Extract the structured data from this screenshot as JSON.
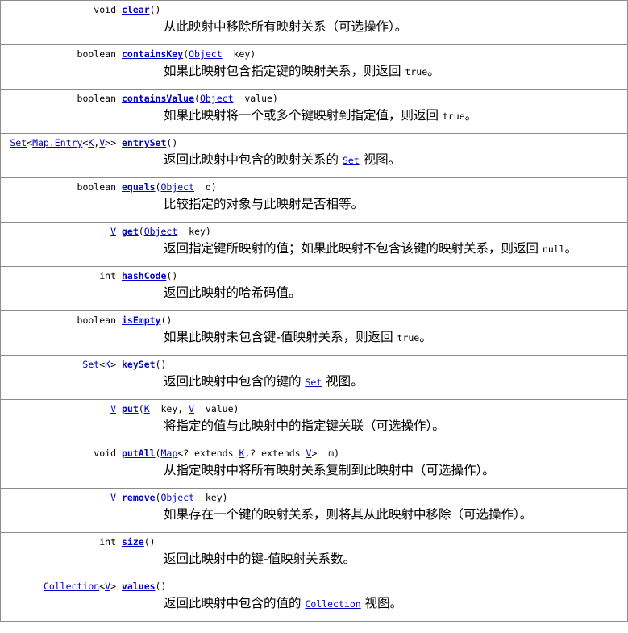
{
  "rows": [
    {
      "type": [
        {
          "t": "void"
        }
      ],
      "method": "clear",
      "params": [
        {
          "t": "()"
        }
      ],
      "desc": [
        {
          "t": "从此映射中移除所有映射关系（可选操作）。"
        }
      ]
    },
    {
      "type": [
        {
          "t": "boolean"
        }
      ],
      "method": "containsKey",
      "params": [
        {
          "t": "("
        },
        {
          "t": "Object",
          "link": true
        },
        {
          "t": "  key)"
        }
      ],
      "desc": [
        {
          "t": "如果此映射包含指定键的映射关系，则返回 "
        },
        {
          "t": "true",
          "code": true
        },
        {
          "t": "。"
        }
      ]
    },
    {
      "type": [
        {
          "t": "boolean"
        }
      ],
      "method": "containsValue",
      "params": [
        {
          "t": "("
        },
        {
          "t": "Object",
          "link": true
        },
        {
          "t": "  value)"
        }
      ],
      "desc": [
        {
          "t": "如果此映射将一个或多个键映射到指定值，则返回 "
        },
        {
          "t": "true",
          "code": true
        },
        {
          "t": "。"
        }
      ]
    },
    {
      "type": [
        {
          "t": "Set",
          "link": true
        },
        {
          "t": "<"
        },
        {
          "t": "Map.Entry",
          "link": true
        },
        {
          "t": "<"
        },
        {
          "t": "K",
          "link": true
        },
        {
          "t": ","
        },
        {
          "t": "V",
          "link": true
        },
        {
          "t": ">>"
        }
      ],
      "method": "entrySet",
      "params": [
        {
          "t": "()"
        }
      ],
      "desc": [
        {
          "t": "返回此映射中包含的映射关系的 "
        },
        {
          "t": "Set",
          "code": true,
          "link": true
        },
        {
          "t": " 视图。"
        }
      ]
    },
    {
      "type": [
        {
          "t": "boolean"
        }
      ],
      "method": "equals",
      "params": [
        {
          "t": "("
        },
        {
          "t": "Object",
          "link": true
        },
        {
          "t": "  o)"
        }
      ],
      "desc": [
        {
          "t": "比较指定的对象与此映射是否相等。"
        }
      ]
    },
    {
      "type": [
        {
          "t": "V",
          "link": true
        }
      ],
      "method": "get",
      "params": [
        {
          "t": "("
        },
        {
          "t": "Object",
          "link": true
        },
        {
          "t": "  key)"
        }
      ],
      "desc": [
        {
          "t": "返回指定键所映射的值；如果此映射不包含该键的映射关系，则返回 "
        },
        {
          "t": "null",
          "code": true
        },
        {
          "t": "。"
        }
      ]
    },
    {
      "type": [
        {
          "t": "int"
        }
      ],
      "method": "hashCode",
      "params": [
        {
          "t": "()"
        }
      ],
      "desc": [
        {
          "t": "返回此映射的哈希码值。"
        }
      ]
    },
    {
      "type": [
        {
          "t": "boolean"
        }
      ],
      "method": "isEmpty",
      "params": [
        {
          "t": "()"
        }
      ],
      "desc": [
        {
          "t": "如果此映射未包含键-值映射关系，则返回 "
        },
        {
          "t": "true",
          "code": true
        },
        {
          "t": "。"
        }
      ]
    },
    {
      "type": [
        {
          "t": "Set",
          "link": true
        },
        {
          "t": "<"
        },
        {
          "t": "K",
          "link": true
        },
        {
          "t": ">"
        }
      ],
      "method": "keySet",
      "params": [
        {
          "t": "()"
        }
      ],
      "desc": [
        {
          "t": "返回此映射中包含的键的 "
        },
        {
          "t": "Set",
          "code": true,
          "link": true
        },
        {
          "t": " 视图。"
        }
      ]
    },
    {
      "type": [
        {
          "t": "V",
          "link": true
        }
      ],
      "method": "put",
      "params": [
        {
          "t": "("
        },
        {
          "t": "K",
          "link": true
        },
        {
          "t": "  key, "
        },
        {
          "t": "V",
          "link": true
        },
        {
          "t": "  value)"
        }
      ],
      "desc": [
        {
          "t": "将指定的值与此映射中的指定键关联（可选操作）。"
        }
      ]
    },
    {
      "type": [
        {
          "t": "void"
        }
      ],
      "method": "putAll",
      "params": [
        {
          "t": "("
        },
        {
          "t": "Map",
          "link": true
        },
        {
          "t": "<? extends "
        },
        {
          "t": "K",
          "link": true
        },
        {
          "t": ",? extends "
        },
        {
          "t": "V",
          "link": true
        },
        {
          "t": ">  m)"
        }
      ],
      "desc": [
        {
          "t": "从指定映射中将所有映射关系复制到此映射中（可选操作）。"
        }
      ]
    },
    {
      "type": [
        {
          "t": "V",
          "link": true
        }
      ],
      "method": "remove",
      "params": [
        {
          "t": "("
        },
        {
          "t": "Object",
          "link": true
        },
        {
          "t": "  key)"
        }
      ],
      "desc": [
        {
          "t": "如果存在一个键的映射关系，则将其从此映射中移除（可选操作）。"
        }
      ]
    },
    {
      "type": [
        {
          "t": "int"
        }
      ],
      "method": "size",
      "params": [
        {
          "t": "()"
        }
      ],
      "desc": [
        {
          "t": "返回此映射中的键-值映射关系数。"
        }
      ]
    },
    {
      "type": [
        {
          "t": "Collection",
          "link": true
        },
        {
          "t": "<"
        },
        {
          "t": "V",
          "link": true
        },
        {
          "t": ">"
        }
      ],
      "method": "values",
      "params": [
        {
          "t": "()"
        }
      ],
      "desc": [
        {
          "t": "返回此映射中包含的值的 "
        },
        {
          "t": "Collection",
          "code": true,
          "link": true
        },
        {
          "t": " 视图。"
        }
      ]
    }
  ]
}
